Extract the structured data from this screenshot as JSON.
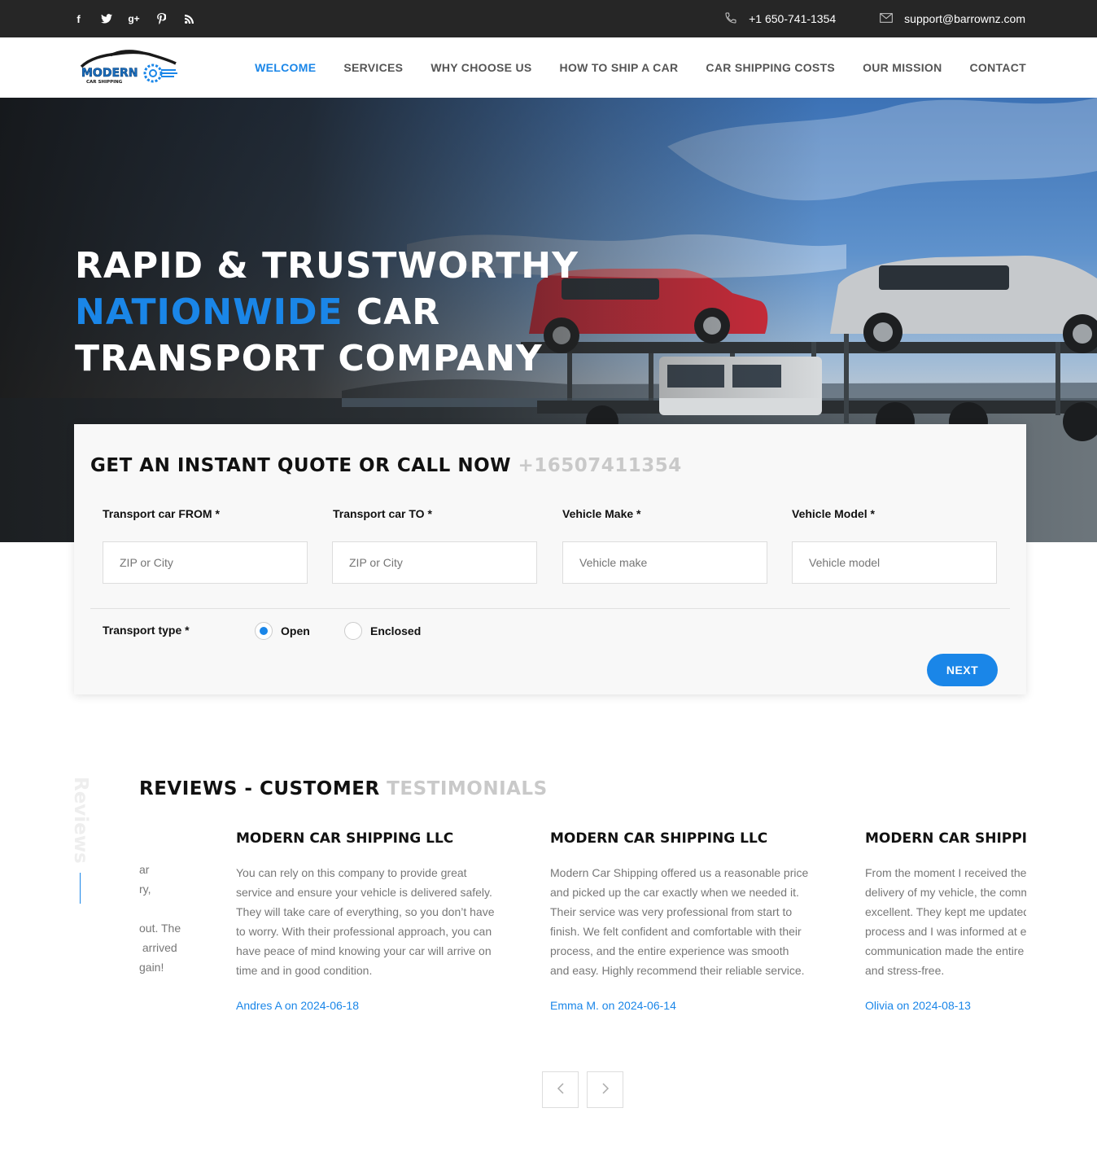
{
  "topbar": {
    "socials": [
      "facebook-icon",
      "twitter-icon",
      "google-plus-icon",
      "pinterest-icon",
      "rss-icon"
    ],
    "phone": "+1 650-741-1354",
    "email": "support@barrownz.com"
  },
  "logo": {
    "word": "MODERN",
    "sub": "CAR SHIPPING"
  },
  "nav": {
    "items": [
      "WELCOME",
      "SERVICES",
      "WHY CHOOSE US",
      "HOW TO SHIP A CAR",
      "CAR SHIPPING COSTS",
      "OUR MISSION",
      "CONTACT"
    ],
    "active": "WELCOME"
  },
  "hero": {
    "line1": "RAPID & TRUSTWORTHY",
    "line2_accent": "NATIONWIDE",
    "line2_rest": " CAR",
    "line3": "TRANSPORT COMPANY"
  },
  "quote": {
    "heading": "GET AN INSTANT QUOTE OR CALL NOW ",
    "phone": "+16507411354",
    "fields": [
      {
        "label": "Transport car FROM *",
        "placeholder": "ZIP or City"
      },
      {
        "label": "Transport car TO *",
        "placeholder": "ZIP or City"
      },
      {
        "label": "Vehicle Make *",
        "placeholder": "Vehicle make"
      },
      {
        "label": "Vehicle Model *",
        "placeholder": "Vehicle model"
      }
    ],
    "transport_type_label": "Transport type *",
    "options": [
      "Open",
      "Enclosed"
    ],
    "selected": "Open",
    "next_label": "NEXT"
  },
  "reviews": {
    "vertical_label": "Reviews",
    "heading_dark": "REVIEWS - CUSTOMER ",
    "heading_gray": "TESTIMONIALS",
    "partial_left": "ar\nry,\n\nout. The\n arrived\ngain!",
    "items": [
      {
        "title": "MODERN CAR SHIPPING LLC",
        "text": "You can rely on this company to provide great service and ensure your vehicle is delivered safely. They will take care of everything, so you don’t have to worry. With their professional approach, you can have peace of mind knowing your car will arrive on time and in good condition.",
        "author": "Andres A on 2024-06-18"
      },
      {
        "title": "MODERN CAR SHIPPING LLC",
        "text": "Modern Car Shipping offered us a reasonable price and picked up the car exactly when we needed it. Their service was very professional from start to finish. We felt confident and comfortable with their process, and the entire experience was smooth and easy. Highly recommend their reliable service.",
        "author": "Emma M. on 2024-06-14"
      },
      {
        "title": "MODERN CAR SHIPPING LLC",
        "text": "From the moment I received the quote, pickup and delivery of my vehicle, the communication was excellent. They kept me updated throughout the process and I was informed at every step. The communication made the entire process smooth and stress-free.",
        "author": "Olivia on 2024-08-13"
      }
    ],
    "prev_icon": "chevron-left-icon",
    "next_icon": "chevron-right-icon"
  },
  "colors": {
    "accent": "#1a86e8",
    "topbar": "#262626",
    "muted_heading": "#c9c9c9"
  }
}
